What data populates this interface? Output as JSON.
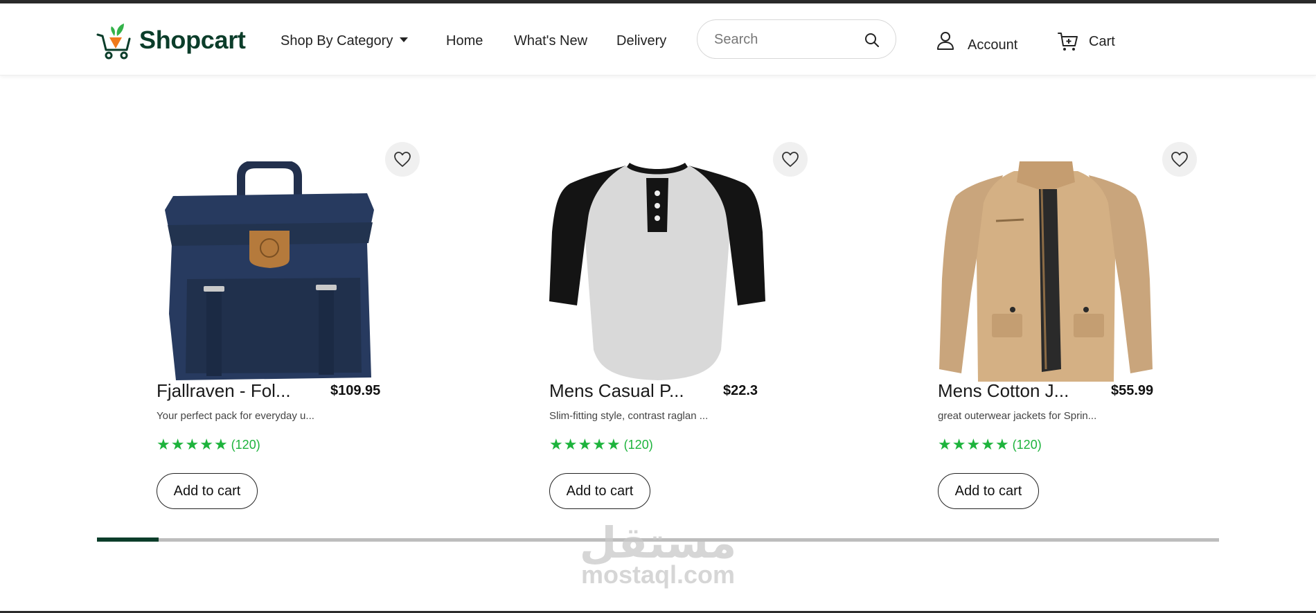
{
  "brand": {
    "name": "Shopcart"
  },
  "nav": {
    "category_label": "Shop By Category",
    "links": [
      "Home",
      "What's New",
      "Delivery"
    ]
  },
  "search": {
    "placeholder": "Search"
  },
  "account": {
    "label": "Account"
  },
  "cart": {
    "label": "Cart"
  },
  "colors": {
    "brand_dark": "#0b3d2a",
    "rating_green": "#1db33c",
    "logo_orange": "#f07a1a",
    "logo_green": "#33b249"
  },
  "products": [
    {
      "title": "Fjallraven - Fol...",
      "price": "$109.95",
      "description": "Your perfect pack for everyday u...",
      "rating_count": "(120)",
      "rating_stars": 5,
      "button": "Add to cart"
    },
    {
      "title": "Mens Casual P...",
      "price": "$22.3",
      "description": "Slim-fitting style, contrast raglan ...",
      "rating_count": "(120)",
      "rating_stars": 5,
      "button": "Add to cart"
    },
    {
      "title": "Mens Cotton J...",
      "price": "$55.99",
      "description": "great outerwear jackets for Sprin...",
      "rating_count": "(120)",
      "rating_stars": 5,
      "button": "Add to cart"
    }
  ],
  "carousel": {
    "scroll_progress_fraction": 0.055
  },
  "watermark": {
    "arabic": "مستقل",
    "latin": "mostaql.com"
  }
}
